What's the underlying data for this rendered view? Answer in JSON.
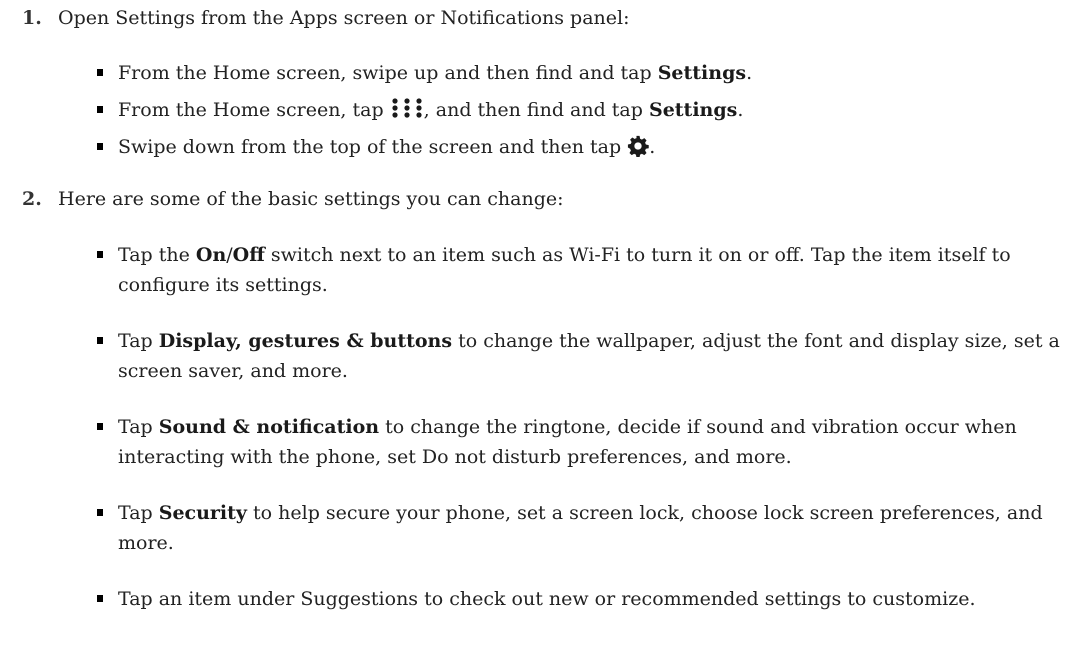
{
  "steps": [
    {
      "number": "1.",
      "text": "Open Settings from the Apps screen or Notifications panel:",
      "bullets": [
        {
          "pre": "From the Home screen, swipe up and then find and tap ",
          "bold": "Settings",
          "post": "."
        },
        {
          "pre": "From the Home screen, tap ",
          "icon": "apps-dots-icon",
          "mid": ", and then find and tap ",
          "bold": "Settings",
          "post": "."
        },
        {
          "pre": "Swipe down from the top of the screen and then tap ",
          "icon": "gear-icon",
          "post": "."
        }
      ]
    },
    {
      "number": "2.",
      "text": "Here are some of the basic settings you can change:",
      "bullets": [
        {
          "pre": "Tap the ",
          "bold": "On",
          "slash": "/",
          "bold2": "Off",
          "post": " switch next to an item such as Wi-Fi to turn it on or off. Tap the item itself to configure its settings."
        },
        {
          "pre": "Tap ",
          "bold": "Display, gestures & buttons",
          "post": " to change the wallpaper, adjust the font and display size, set a screen saver, and more."
        },
        {
          "pre": "Tap ",
          "bold": "Sound & notification",
          "post": " to change the ringtone, decide if sound and vibration occur when interacting with the phone, set Do not disturb preferences, and more."
        },
        {
          "pre": "Tap ",
          "bold": "Security",
          "post": " to help secure your phone, set a screen lock, choose lock screen preferences, and more."
        },
        {
          "pre": "Tap an item under Suggestions to check out new or recommended settings to customize."
        }
      ]
    }
  ]
}
